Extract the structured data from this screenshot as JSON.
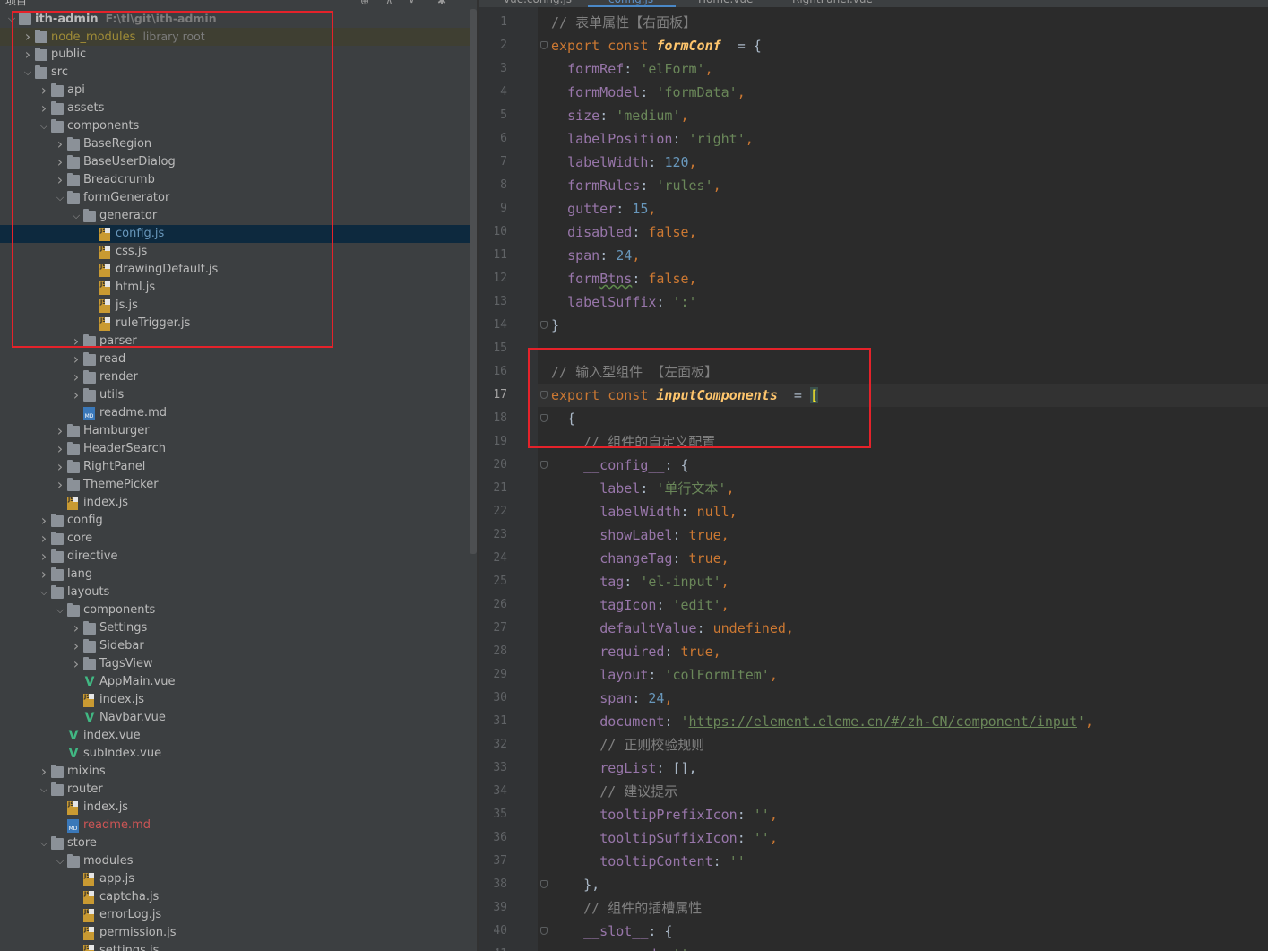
{
  "project_panel": {
    "title": "项目",
    "root": {
      "name": "ith-admin",
      "path": "F:\\tl\\git\\ith-admin"
    },
    "items": [
      {
        "depth": 0,
        "arrow": "down",
        "icon": "folder",
        "label": "ith-admin",
        "hint": "F:\\tl\\git\\ith-admin",
        "style": "bold"
      },
      {
        "depth": 1,
        "arrow": "right",
        "icon": "folder",
        "label": "node_modules",
        "hint": "library root",
        "style": "yellow",
        "row": "excluded"
      },
      {
        "depth": 1,
        "arrow": "right",
        "icon": "folder",
        "label": "public"
      },
      {
        "depth": 1,
        "arrow": "down",
        "icon": "folder",
        "label": "src"
      },
      {
        "depth": 2,
        "arrow": "right",
        "icon": "folder",
        "label": "api"
      },
      {
        "depth": 2,
        "arrow": "right",
        "icon": "folder",
        "label": "assets"
      },
      {
        "depth": 2,
        "arrow": "down",
        "icon": "folder",
        "label": "components"
      },
      {
        "depth": 3,
        "arrow": "right",
        "icon": "folder",
        "label": "BaseRegion"
      },
      {
        "depth": 3,
        "arrow": "right",
        "icon": "folder",
        "label": "BaseUserDialog"
      },
      {
        "depth": 3,
        "arrow": "right",
        "icon": "folder",
        "label": "Breadcrumb"
      },
      {
        "depth": 3,
        "arrow": "down",
        "icon": "folder",
        "label": "formGenerator"
      },
      {
        "depth": 4,
        "arrow": "down",
        "icon": "folder",
        "label": "generator"
      },
      {
        "depth": 5,
        "arrow": "",
        "icon": "js",
        "label": "config.js",
        "style": "blue",
        "row": "selected"
      },
      {
        "depth": 5,
        "arrow": "",
        "icon": "js",
        "label": "css.js"
      },
      {
        "depth": 5,
        "arrow": "",
        "icon": "js",
        "label": "drawingDefault.js"
      },
      {
        "depth": 5,
        "arrow": "",
        "icon": "js",
        "label": "html.js"
      },
      {
        "depth": 5,
        "arrow": "",
        "icon": "js",
        "label": "js.js"
      },
      {
        "depth": 5,
        "arrow": "",
        "icon": "js",
        "label": "ruleTrigger.js"
      },
      {
        "depth": 4,
        "arrow": "right",
        "icon": "folder",
        "label": "parser"
      },
      {
        "depth": 4,
        "arrow": "right",
        "icon": "folder",
        "label": "read"
      },
      {
        "depth": 4,
        "arrow": "right",
        "icon": "folder",
        "label": "render"
      },
      {
        "depth": 4,
        "arrow": "right",
        "icon": "folder",
        "label": "utils"
      },
      {
        "depth": 4,
        "arrow": "",
        "icon": "md",
        "label": "readme.md"
      },
      {
        "depth": 3,
        "arrow": "right",
        "icon": "folder",
        "label": "Hamburger"
      },
      {
        "depth": 3,
        "arrow": "right",
        "icon": "folder",
        "label": "HeaderSearch"
      },
      {
        "depth": 3,
        "arrow": "right",
        "icon": "folder",
        "label": "RightPanel"
      },
      {
        "depth": 3,
        "arrow": "right",
        "icon": "folder",
        "label": "ThemePicker"
      },
      {
        "depth": 3,
        "arrow": "",
        "icon": "js",
        "label": "index.js"
      },
      {
        "depth": 2,
        "arrow": "right",
        "icon": "folder",
        "label": "config"
      },
      {
        "depth": 2,
        "arrow": "right",
        "icon": "folder",
        "label": "core"
      },
      {
        "depth": 2,
        "arrow": "right",
        "icon": "folder",
        "label": "directive"
      },
      {
        "depth": 2,
        "arrow": "right",
        "icon": "folder",
        "label": "lang"
      },
      {
        "depth": 2,
        "arrow": "down",
        "icon": "folder",
        "label": "layouts"
      },
      {
        "depth": 3,
        "arrow": "down",
        "icon": "folder",
        "label": "components"
      },
      {
        "depth": 4,
        "arrow": "right",
        "icon": "folder",
        "label": "Settings"
      },
      {
        "depth": 4,
        "arrow": "right",
        "icon": "folder",
        "label": "Sidebar"
      },
      {
        "depth": 4,
        "arrow": "right",
        "icon": "folder",
        "label": "TagsView"
      },
      {
        "depth": 4,
        "arrow": "",
        "icon": "vue",
        "label": "AppMain.vue"
      },
      {
        "depth": 4,
        "arrow": "",
        "icon": "js",
        "label": "index.js"
      },
      {
        "depth": 4,
        "arrow": "",
        "icon": "vue",
        "label": "Navbar.vue"
      },
      {
        "depth": 3,
        "arrow": "",
        "icon": "vue",
        "label": "index.vue"
      },
      {
        "depth": 3,
        "arrow": "",
        "icon": "vue",
        "label": "subIndex.vue"
      },
      {
        "depth": 2,
        "arrow": "right",
        "icon": "folder",
        "label": "mixins"
      },
      {
        "depth": 2,
        "arrow": "down",
        "icon": "folder",
        "label": "router"
      },
      {
        "depth": 3,
        "arrow": "",
        "icon": "js",
        "label": "index.js"
      },
      {
        "depth": 3,
        "arrow": "",
        "icon": "md",
        "label": "readme.md",
        "style": "red"
      },
      {
        "depth": 2,
        "arrow": "down",
        "icon": "folder",
        "label": "store"
      },
      {
        "depth": 3,
        "arrow": "down",
        "icon": "folder",
        "label": "modules"
      },
      {
        "depth": 4,
        "arrow": "",
        "icon": "js",
        "label": "app.js"
      },
      {
        "depth": 4,
        "arrow": "",
        "icon": "js",
        "label": "captcha.js"
      },
      {
        "depth": 4,
        "arrow": "",
        "icon": "js",
        "label": "errorLog.js"
      },
      {
        "depth": 4,
        "arrow": "",
        "icon": "js",
        "label": "permission.js"
      },
      {
        "depth": 4,
        "arrow": "",
        "icon": "js",
        "label": "settings.js"
      }
    ]
  },
  "editor": {
    "tabs": [
      {
        "label": "vue.config.js",
        "active": false
      },
      {
        "label": "config.js",
        "active": true
      },
      {
        "label": "Home.vue",
        "active": false
      },
      {
        "label": "RightPanel.vue",
        "active": false
      }
    ],
    "current_line": 17,
    "lines": [
      [
        [
          "cm",
          "// 表单属性【右面板】"
        ]
      ],
      [
        [
          "kw",
          "export const "
        ],
        [
          "fn",
          "formConf"
        ],
        [
          "",
          "  = {"
        ]
      ],
      [
        [
          "",
          "  "
        ],
        [
          "prop",
          "formRef"
        ],
        [
          "",
          ": "
        ],
        [
          "str",
          "'elForm'"
        ],
        [
          "kw",
          ","
        ]
      ],
      [
        [
          "",
          "  "
        ],
        [
          "prop",
          "formModel"
        ],
        [
          "",
          ": "
        ],
        [
          "str",
          "'formData'"
        ],
        [
          "kw",
          ","
        ]
      ],
      [
        [
          "",
          "  "
        ],
        [
          "prop",
          "size"
        ],
        [
          "",
          ": "
        ],
        [
          "str",
          "'medium'"
        ],
        [
          "kw",
          ","
        ]
      ],
      [
        [
          "",
          "  "
        ],
        [
          "prop",
          "labelPosition"
        ],
        [
          "",
          ": "
        ],
        [
          "str",
          "'right'"
        ],
        [
          "kw",
          ","
        ]
      ],
      [
        [
          "",
          "  "
        ],
        [
          "prop",
          "labelWidth"
        ],
        [
          "",
          ": "
        ],
        [
          "num",
          "120"
        ],
        [
          "kw",
          ","
        ]
      ],
      [
        [
          "",
          "  "
        ],
        [
          "prop",
          "formRules"
        ],
        [
          "",
          ": "
        ],
        [
          "str",
          "'rules'"
        ],
        [
          "kw",
          ","
        ]
      ],
      [
        [
          "",
          "  "
        ],
        [
          "prop",
          "gutter"
        ],
        [
          "",
          ": "
        ],
        [
          "num",
          "15"
        ],
        [
          "kw",
          ","
        ]
      ],
      [
        [
          "",
          "  "
        ],
        [
          "prop",
          "disabled"
        ],
        [
          "",
          ": "
        ],
        [
          "kw",
          "false,"
        ]
      ],
      [
        [
          "",
          "  "
        ],
        [
          "prop",
          "span"
        ],
        [
          "",
          ": "
        ],
        [
          "num",
          "24"
        ],
        [
          "kw",
          ","
        ]
      ],
      [
        [
          "",
          "  "
        ],
        [
          "prop",
          "form"
        ],
        [
          "prop typo",
          "Btns"
        ],
        [
          "",
          ": "
        ],
        [
          "kw",
          "false,"
        ]
      ],
      [
        [
          "",
          "  "
        ],
        [
          "prop",
          "labelSuffix"
        ],
        [
          "",
          ": "
        ],
        [
          "str",
          "':'"
        ]
      ],
      [
        [
          "",
          "}"
        ]
      ],
      [
        [
          "",
          ""
        ]
      ],
      [
        [
          "cm",
          "// 输入型组件 【左面板】"
        ]
      ],
      [
        [
          "kw",
          "export const "
        ],
        [
          "fn",
          "inputComponents"
        ],
        [
          "",
          "  = "
        ],
        [
          "brk",
          "["
        ]
      ],
      [
        [
          "",
          "  {"
        ]
      ],
      [
        [
          "",
          "    "
        ],
        [
          "cm",
          "// 组件的自定义配置"
        ]
      ],
      [
        [
          "",
          "    "
        ],
        [
          "prop",
          "__config__"
        ],
        [
          "",
          ": {"
        ]
      ],
      [
        [
          "",
          "      "
        ],
        [
          "prop",
          "label"
        ],
        [
          "",
          ": "
        ],
        [
          "str",
          "'单行文本'"
        ],
        [
          "kw",
          ","
        ]
      ],
      [
        [
          "",
          "      "
        ],
        [
          "prop",
          "labelWidth"
        ],
        [
          "",
          ": "
        ],
        [
          "kw",
          "null,"
        ]
      ],
      [
        [
          "",
          "      "
        ],
        [
          "prop",
          "showLabel"
        ],
        [
          "",
          ": "
        ],
        [
          "kw",
          "true,"
        ]
      ],
      [
        [
          "",
          "      "
        ],
        [
          "prop",
          "changeTag"
        ],
        [
          "",
          ": "
        ],
        [
          "kw",
          "true,"
        ]
      ],
      [
        [
          "",
          "      "
        ],
        [
          "prop",
          "tag"
        ],
        [
          "",
          ": "
        ],
        [
          "str",
          "'el-input'"
        ],
        [
          "kw",
          ","
        ]
      ],
      [
        [
          "",
          "      "
        ],
        [
          "prop",
          "tagIcon"
        ],
        [
          "",
          ": "
        ],
        [
          "str",
          "'edit'"
        ],
        [
          "kw",
          ","
        ]
      ],
      [
        [
          "",
          "      "
        ],
        [
          "prop",
          "defaultValue"
        ],
        [
          "",
          ": "
        ],
        [
          "kw",
          "undefined,"
        ]
      ],
      [
        [
          "",
          "      "
        ],
        [
          "prop",
          "required"
        ],
        [
          "",
          ": "
        ],
        [
          "kw",
          "true,"
        ]
      ],
      [
        [
          "",
          "      "
        ],
        [
          "prop",
          "layout"
        ],
        [
          "",
          ": "
        ],
        [
          "str",
          "'colFormItem'"
        ],
        [
          "kw",
          ","
        ]
      ],
      [
        [
          "",
          "      "
        ],
        [
          "prop",
          "span"
        ],
        [
          "",
          ": "
        ],
        [
          "num",
          "24"
        ],
        [
          "kw",
          ","
        ]
      ],
      [
        [
          "",
          "      "
        ],
        [
          "prop",
          "document"
        ],
        [
          "",
          ": "
        ],
        [
          "str",
          "'"
        ],
        [
          "link",
          "https://element.eleme.cn/#/zh-CN/component/input"
        ],
        [
          "str",
          "'"
        ],
        [
          "kw",
          ","
        ]
      ],
      [
        [
          "",
          "      "
        ],
        [
          "cm",
          "// 正则校验规则"
        ]
      ],
      [
        [
          "",
          "      "
        ],
        [
          "prop",
          "regList"
        ],
        [
          "",
          ": [],"
        ]
      ],
      [
        [
          "",
          "      "
        ],
        [
          "cm",
          "// 建议提示"
        ]
      ],
      [
        [
          "",
          "      "
        ],
        [
          "prop",
          "tooltipPrefixIcon"
        ],
        [
          "",
          ": "
        ],
        [
          "str",
          "''"
        ],
        [
          "kw",
          ","
        ]
      ],
      [
        [
          "",
          "      "
        ],
        [
          "prop",
          "tooltipSuffixIcon"
        ],
        [
          "",
          ": "
        ],
        [
          "str",
          "''"
        ],
        [
          "kw",
          ","
        ]
      ],
      [
        [
          "",
          "      "
        ],
        [
          "prop",
          "tooltipContent"
        ],
        [
          "",
          ": "
        ],
        [
          "str",
          "''"
        ]
      ],
      [
        [
          "",
          "    },"
        ]
      ],
      [
        [
          "",
          "    "
        ],
        [
          "cm",
          "// 组件的插槽属性"
        ]
      ],
      [
        [
          "",
          "    "
        ],
        [
          "prop",
          "__slot__"
        ],
        [
          "",
          ": {"
        ]
      ],
      [
        [
          "",
          "      "
        ],
        [
          "prop",
          "prepend"
        ],
        [
          "",
          ": "
        ],
        [
          "str",
          "''"
        ],
        [
          "kw",
          ","
        ]
      ]
    ]
  }
}
